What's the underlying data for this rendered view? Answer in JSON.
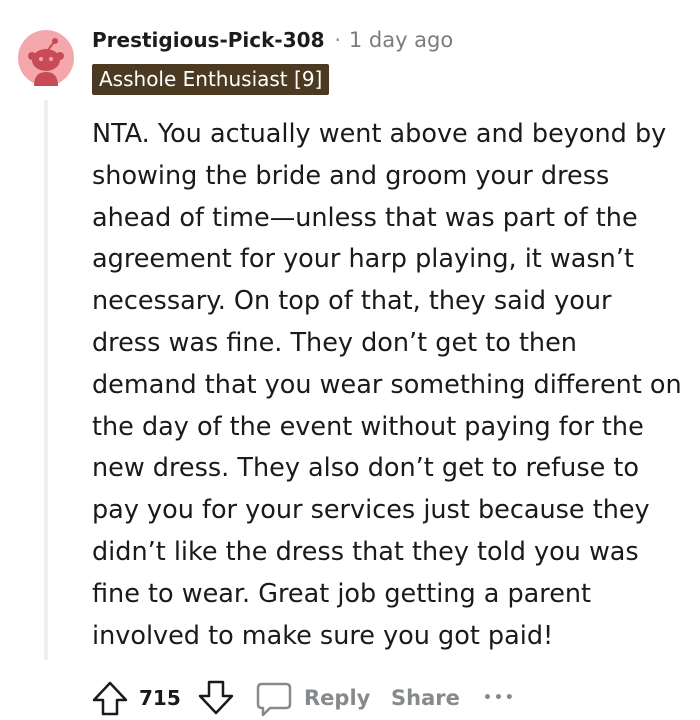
{
  "comment": {
    "author": "Prestigious-Pick-308",
    "separator": "·",
    "time": "1 day ago",
    "flair": "Asshole Enthusiast [9]",
    "body": "NTA. You actually went above and beyond by showing the bride and groom your dress ahead of time—unless that was part of the agreement for your harp playing, it wasn’t necessary. On top of that, they said your dress was fine. They don’t get to then demand that you wear something different on the day of the event without paying for the new dress. They also don’t get to refuse to pay you for your services just because they didn’t like the dress that they told you was fine to wear. Great job getting a parent involved to make sure you got paid!",
    "votes": "715"
  },
  "actions": {
    "reply_label": "Reply",
    "share_label": "Share",
    "more_label": "•••"
  },
  "colors": {
    "flair_bg": "#4b3a21",
    "avatar_bg": "#f4a8ab",
    "muted_text": "#878a8c",
    "thread_line": "#edeff1"
  },
  "icons": {
    "avatar": "snoo-avatar-icon",
    "upvote": "arrow-up-icon",
    "downvote": "arrow-down-icon",
    "reply": "speech-bubble-icon"
  }
}
